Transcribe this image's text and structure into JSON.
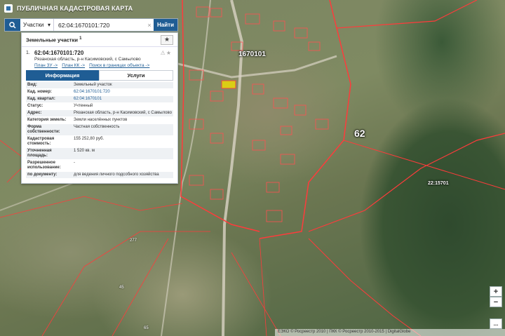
{
  "header": {
    "title": "ПУБЛИЧНАЯ КАДАСТРОВАЯ КАРТА"
  },
  "search": {
    "type_label": "Участки",
    "query": "62:04:1670101:720",
    "find_label": "Найти",
    "clear_symbol": "×"
  },
  "results": {
    "title": "Земельные участки",
    "count": "1",
    "item": {
      "number": "1.",
      "id": "62:04:1670101:720",
      "address": "Рязанская область, р-н Касимовский, с Самылово",
      "links": [
        "План ЗУ ->",
        "План КК ->",
        "Поиск в границах объекта ->"
      ]
    },
    "tabs": {
      "info": "Информация",
      "services": "Услуги"
    },
    "rows": [
      {
        "label": "Вид:",
        "value": "Земельный участок",
        "link": false
      },
      {
        "label": "Кад. номер:",
        "value": "62:04:1670101:720",
        "link": true
      },
      {
        "label": "Кад. квартал:",
        "value": "62:04:1670101",
        "link": true
      },
      {
        "label": "Статус:",
        "value": "Учтенный",
        "link": false
      },
      {
        "label": "Адрес:",
        "value": "Рязанская область, р-н Касимовский, с Самылово",
        "link": false
      },
      {
        "label": "Категория земель:",
        "value": "Земли населённых пунктов",
        "link": false
      },
      {
        "label": "Форма собственности:",
        "value": "Частная собственность",
        "link": false
      },
      {
        "label": "Кадастровая стоимость:",
        "value": "155 252,80 руб.",
        "link": false
      },
      {
        "label": "Уточненная площадь:",
        "value": "1 520 кв. м",
        "link": false
      },
      {
        "label": "Разрешенное использование:",
        "value": "-",
        "link": false
      },
      {
        "label": "по документу:",
        "value": "для ведения личного подсобного хозяйства",
        "link": false
      }
    ]
  },
  "map": {
    "labels": {
      "quarter": "1670101",
      "region_code": "62",
      "block_code": "22:15701",
      "parcel_277": "277",
      "parcel_45": "45",
      "parcel_65": "65"
    }
  },
  "zoom": {
    "in": "+",
    "out": "−",
    "more": "..."
  },
  "copyright": "ЕЭКО © Росреестр 2010 | ПКК © Росреестр 2010-2015 | DigitalGlobe"
}
